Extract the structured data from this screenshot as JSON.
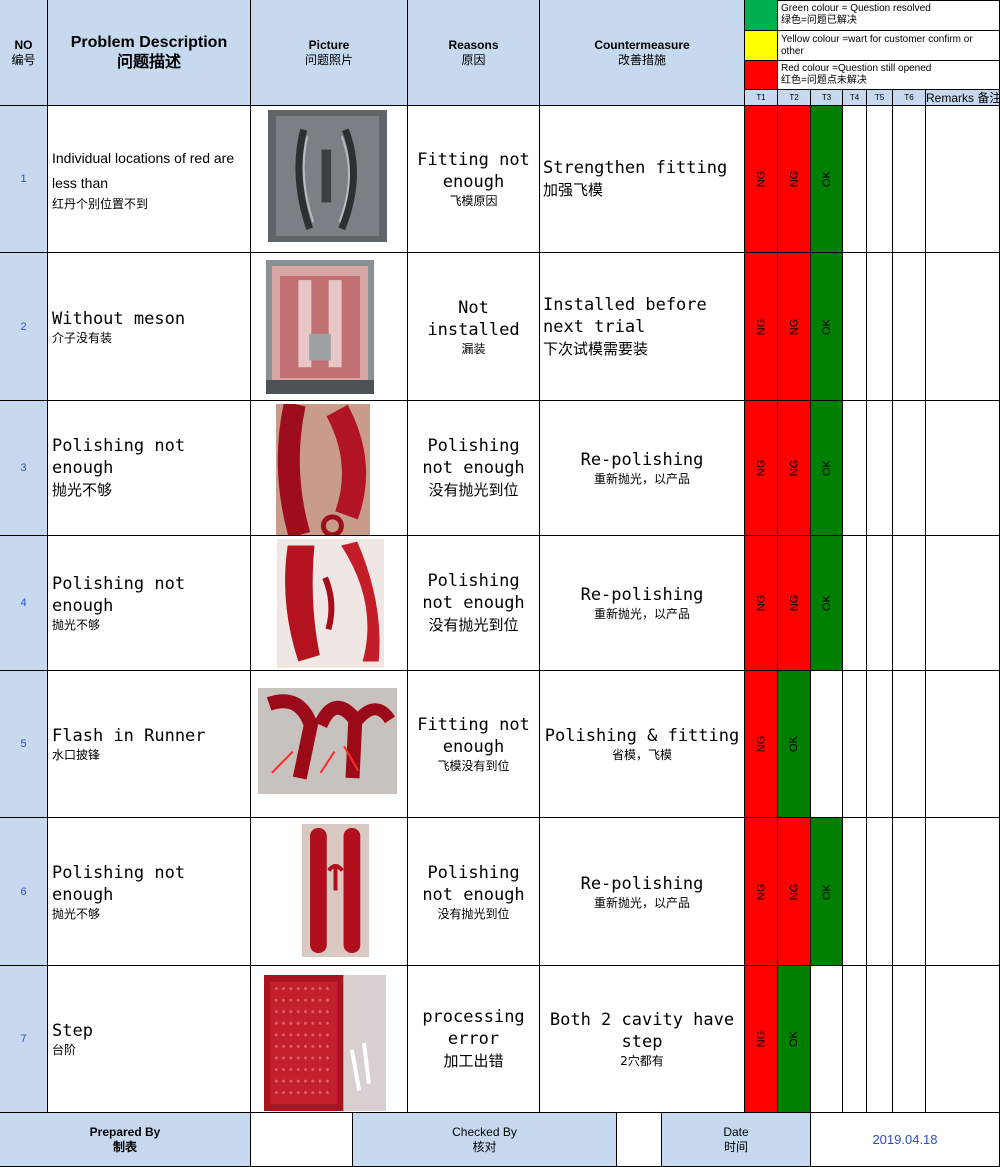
{
  "header": {
    "no": {
      "en": "NO",
      "cn": "编号"
    },
    "problem": {
      "en": "Problem Description",
      "cn": "问题描述"
    },
    "picture": {
      "en": "Picture",
      "cn": "问题照片"
    },
    "reasons": {
      "en": "Reasons",
      "cn": "原因"
    },
    "countermeasure": {
      "en": "Countermeasure",
      "cn": "改善措施"
    },
    "remarks": "Remarks 备注"
  },
  "legend": {
    "green": {
      "en": "Green colour = Question resolved",
      "cn": "绿色=问题已解决",
      "color": "#00b050"
    },
    "yellow": {
      "en": "Yellow colour =wart for customer confirm or other",
      "color": "#ffff00"
    },
    "red": {
      "en": "Red colour =Question still opened",
      "cn": "红色=问题点未解决",
      "color": "#ff0000"
    }
  },
  "trial_headers": [
    "T1",
    "T2",
    "T3",
    "T4",
    "T5",
    "T6"
  ],
  "status_colors": {
    "NG": "#ff0000",
    "OK": "#008000"
  },
  "rows": [
    {
      "no": "1",
      "desc_en": "Individual locations of red are less than",
      "desc_cn": "红丹个别位置不到",
      "reason_en": "Fitting not enough",
      "reason_cn": "飞模原因",
      "counter_en": "Strengthen fitting",
      "counter_cn": "加强飞模",
      "status": [
        "NG",
        "NG",
        "OK"
      ],
      "photo": "gray-mold-photo"
    },
    {
      "no": "2",
      "desc_en": "Without meson",
      "desc_cn": "介子没有装",
      "reason_en": "Not installed",
      "reason_cn": "漏装",
      "counter_en": "Installed before next trial",
      "counter_cn": "下次试模需要装",
      "status": [
        "NG",
        "NG",
        "OK"
      ],
      "photo": "red-dye-mold-photo"
    },
    {
      "no": "3",
      "desc_en": "Polishing not enough",
      "desc_cn": "抛光不够",
      "reason_en": "Polishing not enough",
      "reason_cn": "没有抛光到位",
      "counter_en": "Re-polishing",
      "counter_cn": "重新抛光，以产品",
      "status": [
        "NG",
        "NG",
        "OK"
      ],
      "photo": "red-part-photo"
    },
    {
      "no": "4",
      "desc_en": "Polishing not enough",
      "desc_cn": "抛光不够",
      "reason_en": "Polishing not enough",
      "reason_cn": "没有抛光到位",
      "counter_en": "Re-polishing",
      "counter_cn": "重新抛光，以产品",
      "status": [
        "NG",
        "NG",
        "OK"
      ],
      "photo": "red-parts-pair-photo"
    },
    {
      "no": "5",
      "desc_en": "Flash in Runner",
      "desc_cn": "水口披锋",
      "reason_en": "Fitting not enough",
      "reason_cn": "飞模没有到位",
      "counter_en": "Polishing & fitting",
      "counter_cn": "省模，飞模",
      "status": [
        "NG",
        "OK"
      ],
      "photo": "red-runner-photo"
    },
    {
      "no": "6",
      "desc_en": "Polishing not enough",
      "desc_cn": "抛光不够",
      "reason_en": "Polishing not enough",
      "reason_cn": "没有抛光到位",
      "counter_en": "Re-polishing",
      "counter_cn": "重新抛光，以产品",
      "status": [
        "NG",
        "NG",
        "OK"
      ],
      "photo": "red-bars-photo"
    },
    {
      "no": "7",
      "desc_en": "Step",
      "desc_cn": "台阶",
      "reason_en": "processing error",
      "reason_cn": "加工出错",
      "counter_en": "Both 2 cavity have step",
      "counter_cn": "2穴都有",
      "status": [
        "NG",
        "OK"
      ],
      "photo": "red-closeup-photo"
    }
  ],
  "footer": {
    "prepared": {
      "en": "Prepared By",
      "cn": "制表"
    },
    "checked": {
      "en": "Checked By",
      "cn": "核对"
    },
    "date": {
      "en": "Date",
      "cn": "时间",
      "value": "2019.04.18"
    }
  }
}
